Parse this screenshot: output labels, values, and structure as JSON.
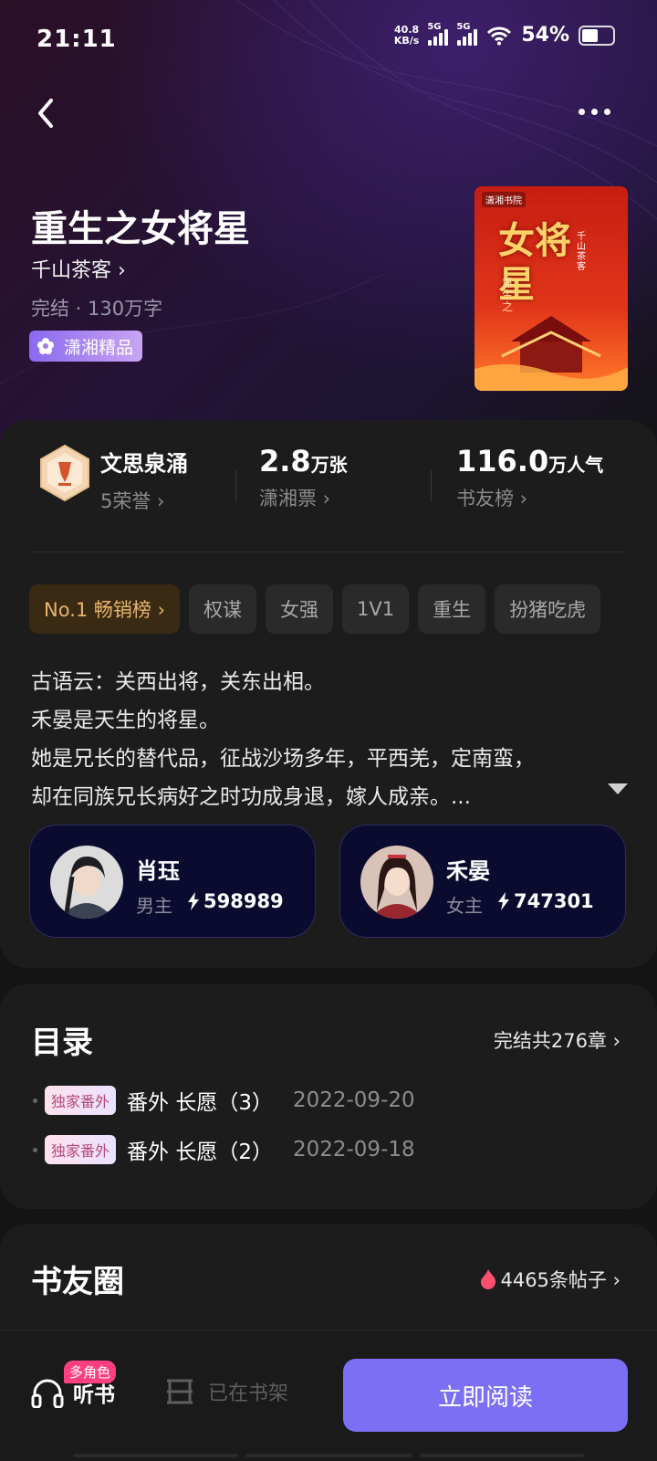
{
  "status_bar": {
    "time": "21:11",
    "net_speed": "40.8",
    "net_unit": "KB/s",
    "sig1": "5G",
    "sig2": "5G",
    "battery": "54%",
    "battery_level": 0.54
  },
  "book": {
    "title": "重生之女将星",
    "author": "千山茶客 ›",
    "meta": "完结 · 130万字",
    "badge": "潇湘精品",
    "cover_text": "女将星",
    "cover_sub": "重生之",
    "cover_publisher": "潇湘书院",
    "cover_author": "千山茶客"
  },
  "stats": {
    "honor_title": "文思泉涌",
    "honor_sub": "5荣誉 ›",
    "tickets_value": "2.8",
    "tickets_unit": "万张",
    "tickets_sub": "潇湘票 ›",
    "popularity_value": "116.0",
    "popularity_unit": "万人气",
    "popularity_sub": "书友榜 ›"
  },
  "tags": [
    "No.1 畅销榜 ›",
    "权谋",
    "女强",
    "1V1",
    "重生",
    "扮猪吃虎"
  ],
  "description": [
    "古语云：关西出将，关东出相。",
    "禾晏是天生的将星。",
    "她是兄长的替代品，征战沙场多年，平西羌，定南蛮，",
    "却在同族兄长病好之时功成身退，嫁人成亲。..."
  ],
  "characters": [
    {
      "name": "肖珏",
      "role": "男主",
      "heat": "598989"
    },
    {
      "name": "禾晏",
      "role": "女主",
      "heat": "747301"
    }
  ],
  "toc": {
    "title": "目录",
    "summary": "完结共276章 ›",
    "chapters": [
      {
        "tag": "独家番外",
        "title": "番外 长愿（3）",
        "date": "2022-09-20"
      },
      {
        "tag": "独家番外",
        "title": "番外 长愿（2）",
        "date": "2022-09-18"
      }
    ]
  },
  "circle": {
    "title": "书友圈",
    "posts": "4465条帖子 ›"
  },
  "bottom": {
    "listen_badge": "多角色",
    "listen": "听书",
    "shelf": "已在书架",
    "read": "立即阅读"
  }
}
